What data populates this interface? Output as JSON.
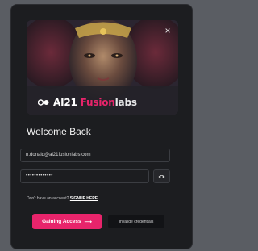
{
  "modal": {
    "close_label": "×",
    "brand": {
      "ai": "AI21",
      "fusion": "Fusion",
      "labs": "labs"
    },
    "title": "Welcome Back",
    "email": {
      "value": "n.donald@ai21fusionlabs.com"
    },
    "password": {
      "value": "•••••••••••••"
    },
    "signup": {
      "prompt": "Don't have an account?",
      "link": "SIGNUP HERE"
    },
    "primary_button": {
      "label": "Gaining Access",
      "arrow": "⟶"
    },
    "status": {
      "text": "Invalide credentials"
    }
  },
  "colors": {
    "accent": "#e8246b",
    "background": "#1c1d20",
    "backdrop": "#5a5d63"
  },
  "icons": {
    "close": "close-icon",
    "eye": "eye-icon",
    "arrow": "arrow-right-icon",
    "logo": "fusion-logo-icon"
  }
}
